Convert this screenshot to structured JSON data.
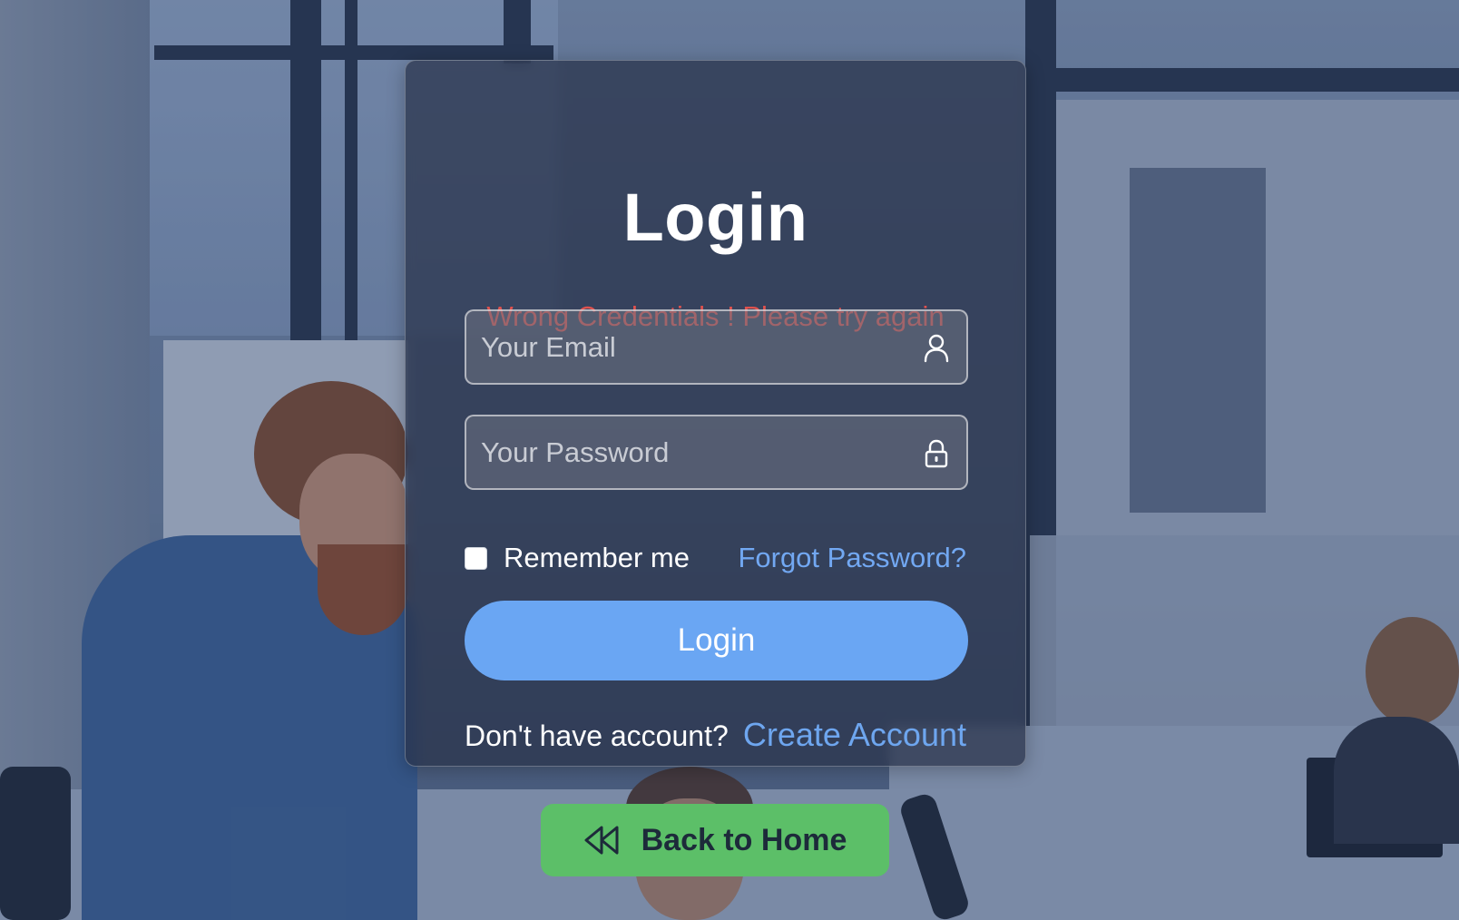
{
  "login_card": {
    "title": "Login",
    "error_message": "Wrong Credentials ! Please try again",
    "email": {
      "placeholder": "Your Email",
      "value": "",
      "icon": "user-icon"
    },
    "password": {
      "placeholder": "Your Password",
      "value": "",
      "icon": "lock-icon"
    },
    "remember_me": {
      "label": "Remember me",
      "checked": false
    },
    "forgot_password_label": "Forgot Password?",
    "submit_label": "Login",
    "signup_prompt": "Don't have account?",
    "signup_link_label": "Create Account"
  },
  "back_home": {
    "label": "Back to Home",
    "icon": "rewind-icon"
  },
  "colors": {
    "error": "#e0524e",
    "link": "#72a8f2",
    "primary_button": "#6aa6f3",
    "home_button": "#5cbf68"
  }
}
